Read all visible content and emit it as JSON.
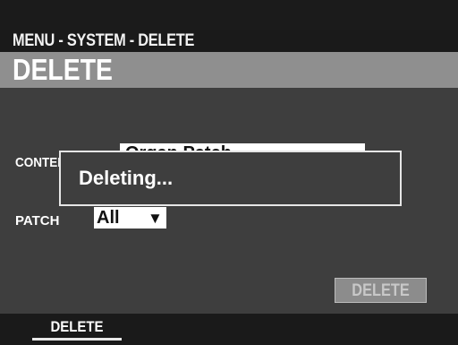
{
  "header": {
    "breadcrumb": "MENU - SYSTEM - DELETE",
    "title": "DELETE"
  },
  "form": {
    "content_label": "CONTENTS",
    "content_value": "Organ Patch",
    "patch_label": "PATCH",
    "patch_value": "All",
    "patch_arrow": "▼"
  },
  "dialog": {
    "message": "Deleting..."
  },
  "actions": {
    "delete_label": "DELETE"
  },
  "tabs": [
    {
      "label": "DELETE"
    }
  ],
  "colors": {
    "background": "#3e3e3e",
    "title_bar": "#8f8f8f",
    "dark_bar": "#1a1a1a",
    "button_disabled": "#8c8c8c"
  }
}
